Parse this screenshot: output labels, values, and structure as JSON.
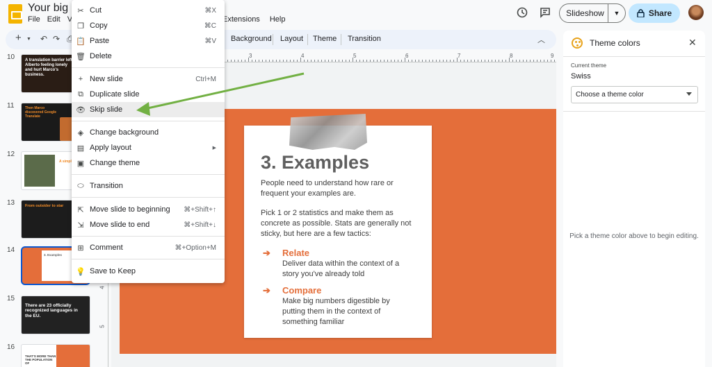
{
  "document": {
    "title": "Your big idea",
    "menu": [
      "File",
      "Edit",
      "View"
    ],
    "menu_right": [
      "Extensions",
      "Help"
    ]
  },
  "header": {
    "slideshow_label": "Slideshow",
    "share_label": "Share"
  },
  "toolbar": {
    "items": [
      "Background",
      "Layout",
      "Theme",
      "Transition"
    ]
  },
  "ruler": {
    "ticks": [
      "3",
      "4",
      "5",
      "6",
      "7",
      "8",
      "9"
    ],
    "vticks": [
      "4",
      "5"
    ]
  },
  "thumbnails": [
    {
      "num": "10",
      "text": "A translation barrier left Alberto feeling lonely and hurt Marco's business."
    },
    {
      "num": "11",
      "text": "Then Marco discovered Google Translate"
    },
    {
      "num": "12",
      "text": "A simple p"
    },
    {
      "num": "13",
      "text": "From outsider to star"
    },
    {
      "num": "14",
      "text": "3. Examples"
    },
    {
      "num": "15",
      "text": "There are 23 officially recognized languages in the EU."
    },
    {
      "num": "16",
      "text": "THAT'S MORE THAN THE POPULATION OF"
    }
  ],
  "context_menu": {
    "items": [
      {
        "label": "Cut",
        "shortcut": "⌘X",
        "icon": "scissors-icon"
      },
      {
        "label": "Copy",
        "shortcut": "⌘C",
        "icon": "copy-icon"
      },
      {
        "label": "Paste",
        "shortcut": "⌘V",
        "icon": "clipboard-icon"
      },
      {
        "label": "Delete",
        "shortcut": "",
        "icon": "trash-icon"
      },
      {
        "label": "New slide",
        "shortcut": "Ctrl+M",
        "icon": "plus-icon"
      },
      {
        "label": "Duplicate slide",
        "shortcut": "",
        "icon": "duplicate-icon"
      },
      {
        "label": "Skip slide",
        "shortcut": "",
        "icon": "eye-icon"
      },
      {
        "label": "Change background",
        "shortcut": "",
        "icon": "paint-bucket-icon"
      },
      {
        "label": "Apply layout",
        "shortcut": "",
        "icon": "layout-icon"
      },
      {
        "label": "Change theme",
        "shortcut": "",
        "icon": "theme-icon"
      },
      {
        "label": "Transition",
        "shortcut": "",
        "icon": "transition-icon"
      },
      {
        "label": "Move slide to beginning",
        "shortcut": "⌘+Shift+↑",
        "icon": "move-top-icon"
      },
      {
        "label": "Move slide to end",
        "shortcut": "⌘+Shift+↓",
        "icon": "move-bottom-icon"
      },
      {
        "label": "Comment",
        "shortcut": "⌘+Option+M",
        "icon": "comment-icon"
      },
      {
        "label": "Save to Keep",
        "shortcut": "",
        "icon": "lightbulb-icon"
      }
    ]
  },
  "slide": {
    "title": "3. Examples",
    "para1": "People need to understand how rare or frequent your examples are.",
    "para2": "Pick 1 or 2 statistics and make them as concrete as possible. Stats are generally not sticky, but here are a few tactics:",
    "tactics": [
      {
        "title": "Relate",
        "desc": "Deliver data within the context of a story you've already told"
      },
      {
        "title": "Compare",
        "desc": "Make big numbers digestible by putting them in the context of something familiar"
      }
    ],
    "accent_color": "#e46e3a"
  },
  "theme_panel": {
    "title": "Theme colors",
    "current_theme_label": "Current theme",
    "current_theme_value": "Swiss",
    "select_placeholder": "Choose a theme color",
    "hint": "Pick a theme color above to begin editing."
  }
}
